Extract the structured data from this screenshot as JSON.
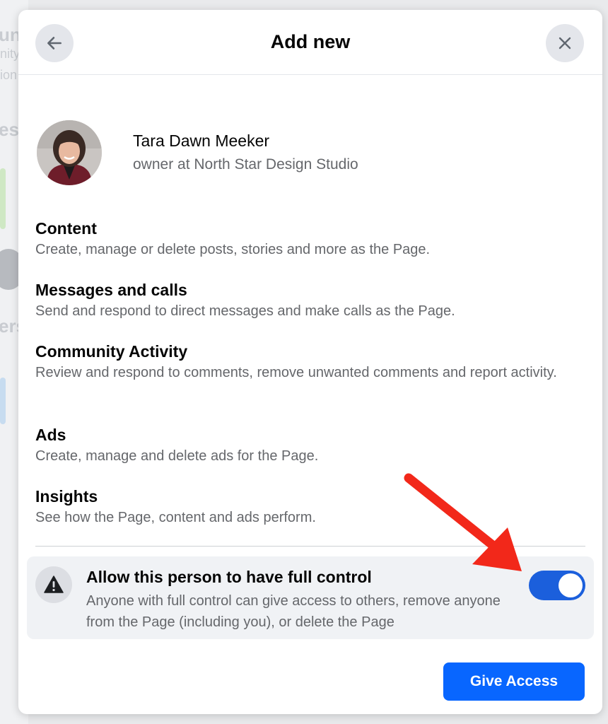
{
  "background": {
    "fragments": [
      "un",
      "nity",
      "ion",
      "es",
      "ers"
    ]
  },
  "dialog": {
    "title": "Add new",
    "back_icon": "arrow-left-icon",
    "close_icon": "close-icon"
  },
  "profile": {
    "name": "Tara Dawn Meeker",
    "subtitle": "owner at North Star Design Studio"
  },
  "permissions": [
    {
      "title": "Content",
      "description": "Create, manage or delete posts, stories and more as the Page."
    },
    {
      "title": "Messages and calls",
      "description": "Send and respond to direct messages and make calls as the Page."
    },
    {
      "title": "Community Activity",
      "description": "Review and respond to comments, remove unwanted comments and report activity."
    },
    {
      "title": "Ads",
      "description": "Create, manage and delete ads for the Page."
    },
    {
      "title": "Insights",
      "description": "See how the Page, content and ads perform."
    }
  ],
  "full_control": {
    "icon": "warning-icon",
    "title": "Allow this person to have full control",
    "description": "Anyone with full control can give access to others, remove anyone from the Page (including you), or delete the Page",
    "enabled": true
  },
  "actions": {
    "give_access_label": "Give Access"
  },
  "colors": {
    "primary": "#0866ff",
    "toggle_on": "#1b5fdc",
    "annotation_arrow": "#f2281a",
    "secondary_text": "#65676b"
  }
}
